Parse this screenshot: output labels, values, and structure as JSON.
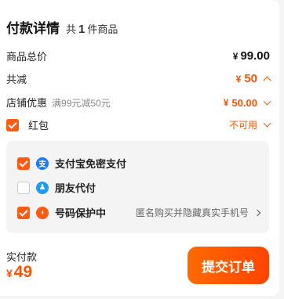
{
  "header": {
    "title": "付款详情",
    "count_prefix": "共",
    "count": "1",
    "count_suffix": "件商品"
  },
  "rows": {
    "total_price": {
      "label": "商品总价",
      "currency": "¥",
      "value": "99.00"
    },
    "discount": {
      "label": "共减",
      "currency": "¥",
      "value": "50"
    },
    "shop_coupon": {
      "label": "店铺优惠",
      "detail": "满99元减50元",
      "currency": "¥",
      "value": "50.00"
    },
    "red_packet": {
      "label": "红包",
      "value": "不可用",
      "checked": true
    }
  },
  "payment_options": [
    {
      "label": "支付宝免密支付",
      "checked": true,
      "icon": "alipay-icon",
      "icon_glyph": "支",
      "color": "#1677ff"
    },
    {
      "label": "朋友代付",
      "checked": false,
      "icon": "friend-pay-icon",
      "icon_glyph": "♟",
      "color": "#1e9bf0"
    },
    {
      "label": "号码保护中",
      "checked": true,
      "icon": "phone-protect-icon",
      "icon_glyph": "◖",
      "color": "#ff5a12",
      "note": "匿名购买并隐藏真实手机号"
    }
  ],
  "footer": {
    "paid_label": "实付款",
    "currency": "¥",
    "amount": "49",
    "submit_label": "提交订单"
  },
  "colors": {
    "accent": "#ff5000",
    "panel_bg": "#f4f4f5"
  }
}
